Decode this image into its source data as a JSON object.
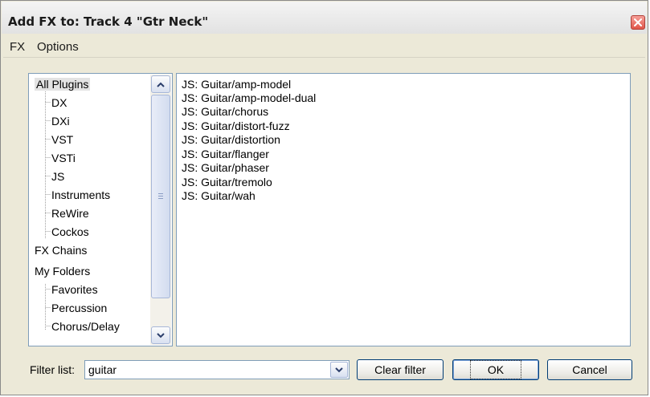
{
  "window": {
    "title": "Add FX to: Track 4 \"Gtr Neck\""
  },
  "menu": {
    "items": [
      "FX",
      "Options"
    ]
  },
  "tree": {
    "items": [
      {
        "label": "All Plugins",
        "level": 0,
        "selected": true
      },
      {
        "label": "DX",
        "level": 1
      },
      {
        "label": "DXi",
        "level": 1
      },
      {
        "label": "VST",
        "level": 1
      },
      {
        "label": "VSTi",
        "level": 1
      },
      {
        "label": "JS",
        "level": 1
      },
      {
        "label": "Instruments",
        "level": 1
      },
      {
        "label": "ReWire",
        "level": 1
      },
      {
        "label": "Cockos",
        "level": 1
      },
      {
        "label": "FX Chains",
        "level": 0
      },
      {
        "label": "My Folders",
        "level": 0
      },
      {
        "label": "Favorites",
        "level": 1
      },
      {
        "label": "Percussion",
        "level": 1
      },
      {
        "label": "Chorus/Delay",
        "level": 1
      }
    ]
  },
  "fx_list": {
    "items": [
      "JS: Guitar/amp-model",
      "JS: Guitar/amp-model-dual",
      "JS: Guitar/chorus",
      "JS: Guitar/distort-fuzz",
      "JS: Guitar/distortion",
      "JS: Guitar/flanger",
      "JS: Guitar/phaser",
      "JS: Guitar/tremolo",
      "JS: Guitar/wah"
    ]
  },
  "filter": {
    "label": "Filter list:",
    "value": "guitar"
  },
  "buttons": {
    "clear_filter": "Clear filter",
    "ok": "OK",
    "cancel": "Cancel"
  },
  "icons": {
    "close": "close-icon",
    "scroll_up": "chevron-up-icon",
    "scroll_down": "chevron-down-icon",
    "grip": "grip-icon",
    "dropdown": "chevron-down-icon"
  },
  "colors": {
    "dialog_bg": "#ece9d8",
    "close_button": "#e05548",
    "border": "#7f9db9"
  }
}
